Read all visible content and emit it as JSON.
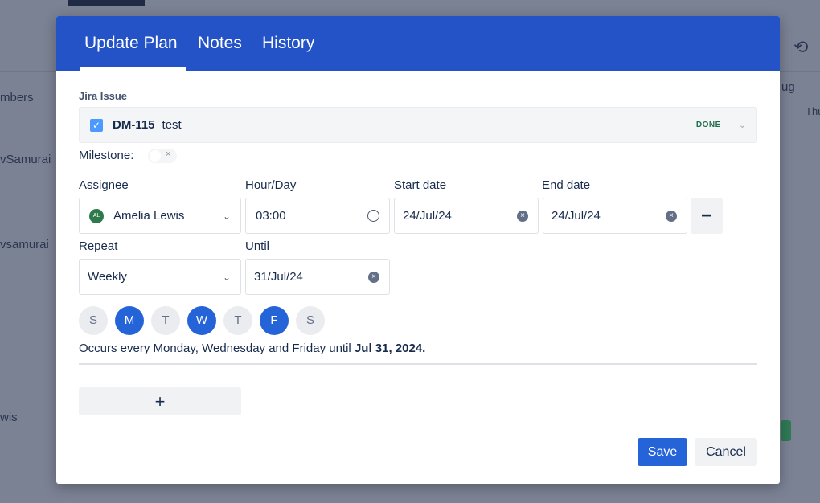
{
  "background": {
    "texts": [
      "mbers",
      "vSamurai",
      "vsamurai",
      "wis",
      "ug",
      "Thu"
    ],
    "refresh_icon": "refresh-icon"
  },
  "tabs": [
    {
      "label": "Update Plan",
      "active": true
    },
    {
      "label": "Notes"
    },
    {
      "label": "History"
    }
  ],
  "jira": {
    "label": "Jira Issue",
    "key": "DM-115",
    "summary": "test",
    "status": "DONE",
    "checked": true
  },
  "milestone": {
    "label": "Milestone:",
    "on": false
  },
  "fields": {
    "assignee": {
      "label": "Assignee",
      "value": "Amelia Lewis",
      "initials": "AL"
    },
    "hour": {
      "label": "Hour/Day",
      "value": "03:00"
    },
    "start": {
      "label": "Start date",
      "value": "24/Jul/24"
    },
    "end": {
      "label": "End date",
      "value": "24/Jul/24"
    },
    "repeat": {
      "label": "Repeat",
      "value": "Weekly"
    },
    "until": {
      "label": "Until",
      "value": "31/Jul/24"
    }
  },
  "days": [
    {
      "l": "S",
      "on": false
    },
    {
      "l": "M",
      "on": true
    },
    {
      "l": "T",
      "on": false
    },
    {
      "l": "W",
      "on": true
    },
    {
      "l": "T",
      "on": false
    },
    {
      "l": "F",
      "on": true
    },
    {
      "l": "S",
      "on": false
    }
  ],
  "summary": {
    "text": "Occurs every Monday, Wednesday and Friday until ",
    "date": "Jul 31, 2024."
  },
  "buttons": {
    "remove": "−",
    "add": "+",
    "save": "Save",
    "cancel": "Cancel"
  },
  "colors": {
    "header": "#2453c8",
    "primary": "#2563d9",
    "done": "#216e4e"
  }
}
